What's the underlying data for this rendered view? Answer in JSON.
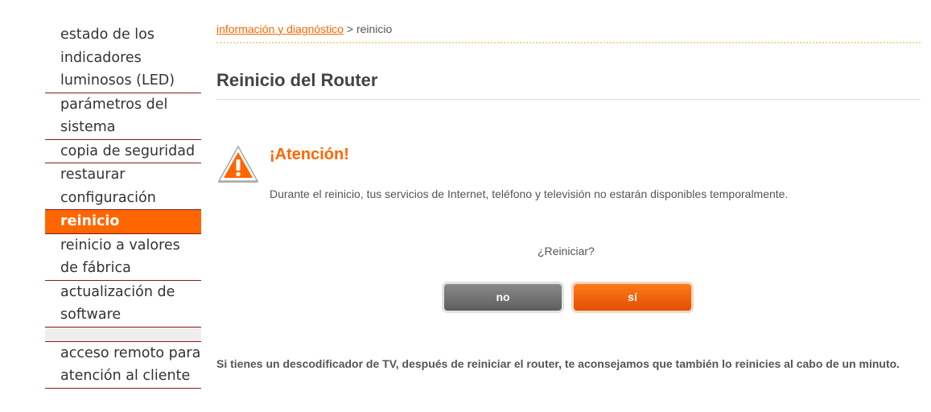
{
  "sidebar": {
    "items": [
      {
        "label": "estado de los indicadores luminosos (LED)",
        "active": false
      },
      {
        "label": "parámetros del sistema",
        "active": false
      },
      {
        "label": "copia de seguridad",
        "active": false
      },
      {
        "label": "restaurar configuración",
        "active": false
      },
      {
        "label": "reinicio",
        "active": true
      },
      {
        "label": "reinicio a valores de fábrica",
        "active": false
      },
      {
        "label": "actualización de software",
        "active": false
      }
    ],
    "extra_items": [
      {
        "label": "acceso remoto para atención al cliente"
      }
    ]
  },
  "breadcrumb": {
    "parent": "información y diagnóstico",
    "separator": ">",
    "current": "reinicio"
  },
  "page": {
    "title": "Reinicio del Router"
  },
  "warning": {
    "icon": "warning-triangle-icon",
    "title": "¡Atención!",
    "text": "Durante el reinicio, tus servicios de Internet, teléfono y televisión no estarán disponibles temporalmente."
  },
  "confirm": {
    "question": "¿Reiniciar?",
    "no_label": "no",
    "yes_label": "sí"
  },
  "note": "Si tienes un descodificador de TV, después de reiniciar el router, te aconsejamos que también lo reinicies al cabo de un minuto.",
  "colors": {
    "accent": "#ff6600",
    "sidebar_border": "#8b1a1a",
    "button_no": "#6e6e6e",
    "button_yes": "#f05a0a"
  }
}
